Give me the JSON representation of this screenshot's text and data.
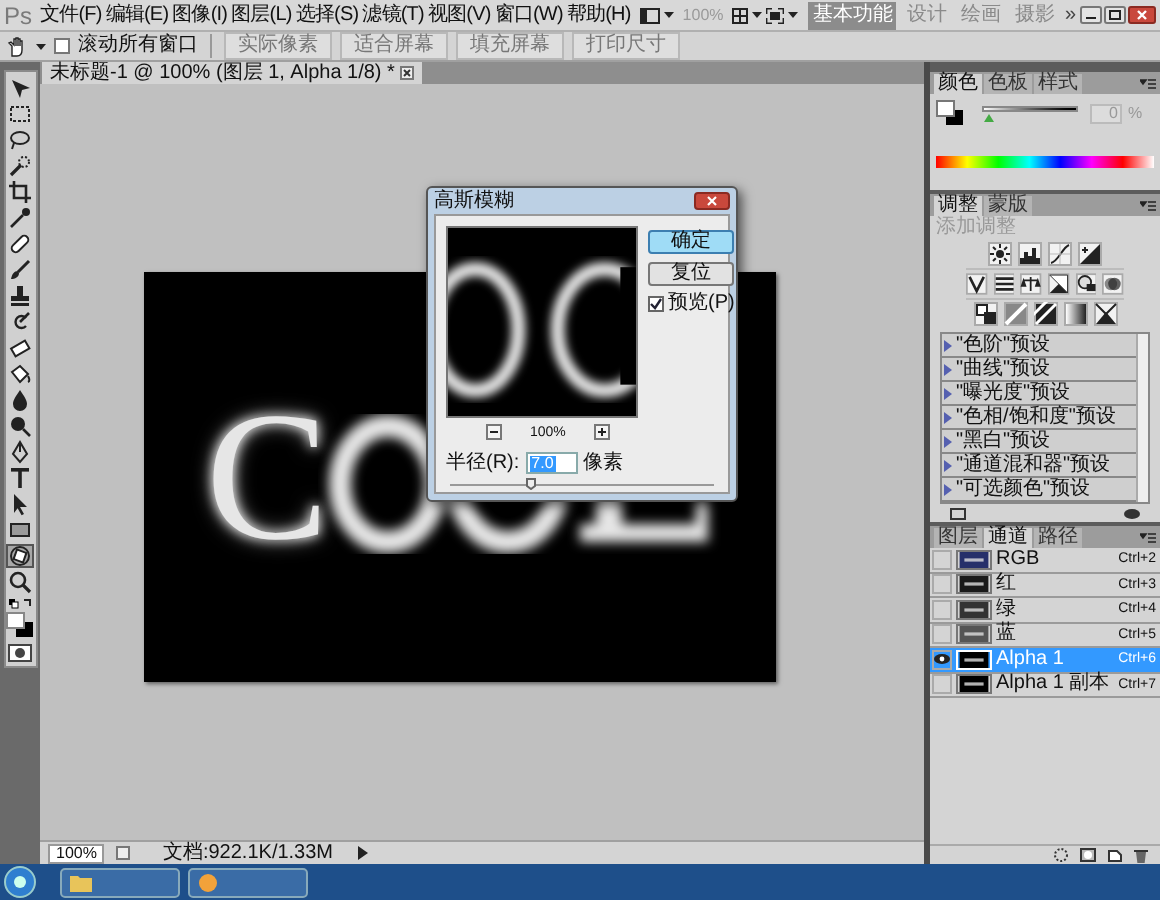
{
  "menu_bar": {
    "app_logo": "Ps",
    "menus": [
      "文件(F)",
      "编辑(E)",
      "图像(I)",
      "图层(L)",
      "选择(S)",
      "滤镜(T)",
      "视图(V)",
      "窗口(W)",
      "帮助(H)"
    ],
    "zoom_level": "100%",
    "workspaces": [
      {
        "label": "基本功能",
        "selected": true
      },
      {
        "label": "设计",
        "selected": false
      },
      {
        "label": "绘画",
        "selected": false
      },
      {
        "label": "摄影",
        "selected": false
      }
    ],
    "more": "»"
  },
  "options_bar": {
    "scroll_all": {
      "label": "滚动所有窗口",
      "checked": false
    },
    "buttons": [
      "实际像素",
      "适合屏幕",
      "填充屏幕",
      "打印尺寸"
    ]
  },
  "document_tab": {
    "title": "未标题-1 @ 100% (图层 1, Alpha 1/8) *"
  },
  "tools": [
    {
      "kind": "move",
      "selected": false
    },
    {
      "kind": "marquee",
      "selected": false
    },
    {
      "kind": "lasso",
      "selected": false
    },
    {
      "kind": "wand",
      "selected": false
    },
    {
      "kind": "crop",
      "selected": false
    },
    {
      "kind": "eyedropper",
      "selected": false
    },
    {
      "kind": "bandage",
      "selected": false
    },
    {
      "kind": "brush",
      "selected": false
    },
    {
      "kind": "stamp",
      "selected": false
    },
    {
      "kind": "swirl",
      "selected": false
    },
    {
      "kind": "eraser",
      "selected": false
    },
    {
      "kind": "bucket",
      "selected": false
    },
    {
      "kind": "drop",
      "selected": false
    },
    {
      "kind": "lollipop",
      "selected": false
    },
    {
      "kind": "pen",
      "selected": false
    },
    {
      "kind": "type",
      "selected": false
    },
    {
      "kind": "pointer",
      "selected": false
    },
    {
      "kind": "rectangle",
      "selected": false
    },
    {
      "kind": "rotate",
      "selected": true
    },
    {
      "kind": "zoom",
      "selected": false
    }
  ],
  "canvas": {
    "text": "C"
  },
  "dialog": {
    "title": "高斯模糊",
    "buttons": [
      {
        "label": "确定",
        "selected": true
      },
      {
        "label": "复位",
        "selected": false
      }
    ],
    "preview": {
      "label": "预览(P)",
      "checked": true
    },
    "zoom": "100%",
    "radius": {
      "label": "半径(R):",
      "value": "7.0",
      "unit": "像素",
      "level": 0.3
    }
  },
  "status_bar": {
    "zoom": "100%",
    "doc_size": "文档:922.1K/1.33M"
  },
  "color_panel": {
    "tabs": [
      {
        "label": "颜色",
        "selected": true
      },
      {
        "label": "色板",
        "selected": false
      },
      {
        "label": "样式",
        "selected": false
      }
    ],
    "value": "0",
    "unit": "%",
    "level": 0
  },
  "adjustments_panel": {
    "tabs": [
      {
        "label": "调整",
        "selected": true
      },
      {
        "label": "蒙版",
        "selected": false
      }
    ],
    "heading": "添加调整",
    "presets": [
      "\"色阶\"预设",
      "\"曲线\"预设",
      "\"曝光度\"预设",
      "\"色相/饱和度\"预设",
      "\"黑白\"预设",
      "\"通道混和器\"预设",
      "\"可选颜色\"预设"
    ]
  },
  "channels_panel": {
    "tabs": [
      {
        "label": "图层",
        "selected": false
      },
      {
        "label": "通道",
        "selected": true
      },
      {
        "label": "路径",
        "selected": false
      }
    ],
    "channels": [
      {
        "name": "RGB",
        "shortcut": "Ctrl+2",
        "visible": false,
        "selected": false,
        "color": "#26306a"
      },
      {
        "name": "红",
        "shortcut": "Ctrl+3",
        "visible": false,
        "selected": false,
        "color": "#1a1a1a"
      },
      {
        "name": "绿",
        "shortcut": "Ctrl+4",
        "visible": false,
        "selected": false,
        "color": "#333333"
      },
      {
        "name": "蓝",
        "shortcut": "Ctrl+5",
        "visible": false,
        "selected": false,
        "color": "#555555"
      },
      {
        "name": "Alpha 1",
        "shortcut": "Ctrl+6",
        "visible": true,
        "selected": true,
        "color": "#000000"
      },
      {
        "name": "Alpha 1 副本",
        "shortcut": "Ctrl+7",
        "visible": false,
        "selected": false,
        "color": "#000000"
      }
    ]
  }
}
